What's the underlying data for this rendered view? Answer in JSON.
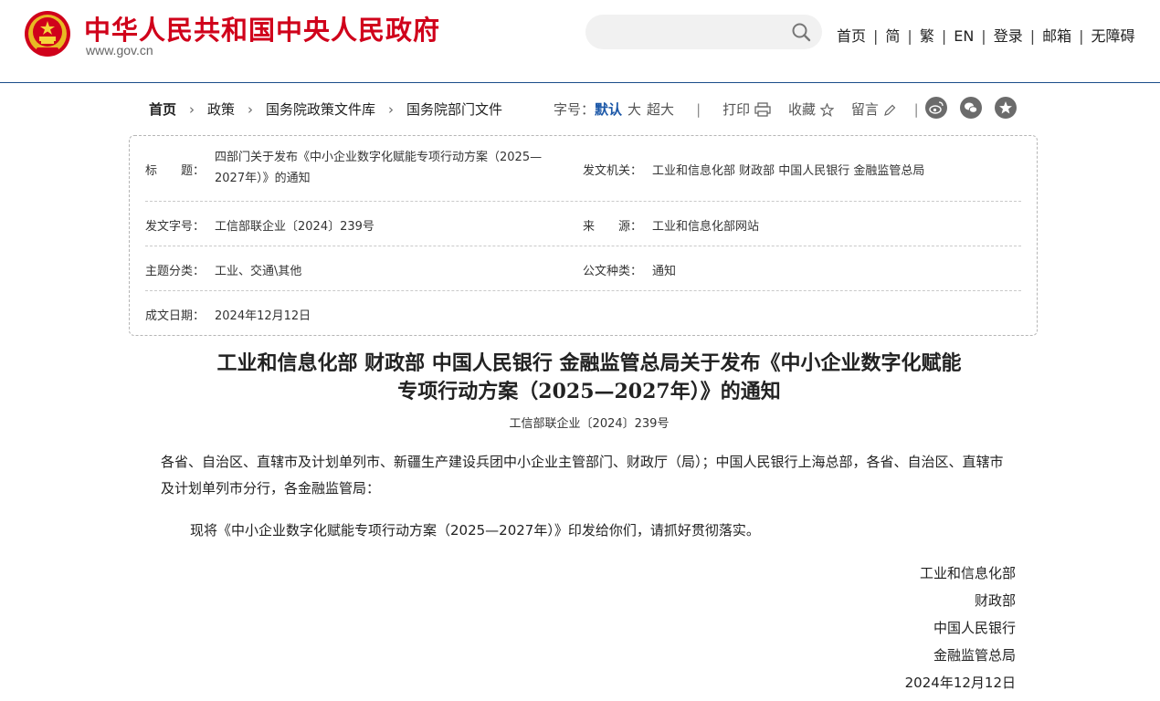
{
  "header": {
    "site_title": "中华人民共和国中央人民政府",
    "site_url": "www.gov.cn",
    "search": {
      "value": "",
      "placeholder": ""
    },
    "nav": [
      "首页",
      "简",
      "繁",
      "EN",
      "登录",
      "邮箱",
      "无障碍"
    ],
    "colors": {
      "brand_red": "#d0021b",
      "divider_blue": "#1a4e8a",
      "accent_blue": "#1c58a8"
    }
  },
  "breadcrumb": [
    "首页",
    "政策",
    "国务院政策文件库",
    "国务院部门文件"
  ],
  "tools": {
    "font_size_label": "字号：",
    "font_sizes": [
      "默认",
      "大",
      "超大"
    ],
    "print": "打印",
    "favorite": "收藏",
    "comment": "留言",
    "share_icons": [
      "weibo-icon",
      "wechat-icon",
      "star-share-icon"
    ]
  },
  "info": {
    "title_label": "标　　题：",
    "title_value": "四部门关于发布《中小企业数字化赋能专项行动方案（2025—2027年）》的通知",
    "issuer_label": "发文机关：",
    "issuer_value": "工业和信息化部  财政部  中国人民银行  金融监管总局",
    "docno_label": "发文字号：",
    "docno_value": "工信部联企业〔2024〕239号",
    "source_label": "来　　源：",
    "source_value": "工业和信息化部网站",
    "topic_label": "主题分类：",
    "topic_value": "工业、交通\\其他",
    "type_label": "公文种类：",
    "type_value": "通知",
    "date_label": "成文日期：",
    "date_value": "2024年12月12日"
  },
  "doc": {
    "title_line1": "工业和信息化部  财政部  中国人民银行  金融监管总局关于发布《中小企业数字化赋能",
    "title_line2": "专项行动方案（2025—2027年）》的通知",
    "doc_number": "工信部联企业〔2024〕239号",
    "para1": "各省、自治区、直辖市及计划单列市、新疆生产建设兵团中小企业主管部门、财政厅（局）；中国人民银行上海总部，各省、自治区、直辖市及计划单列市分行，各金融监管局：",
    "para2": "现将《中小企业数字化赋能专项行动方案（2025—2027年）》印发给你们，请抓好贯彻落实。",
    "signatories": [
      "工业和信息化部",
      "财政部",
      "中国人民银行",
      "金融监管总局",
      "2024年12月12日"
    ]
  }
}
